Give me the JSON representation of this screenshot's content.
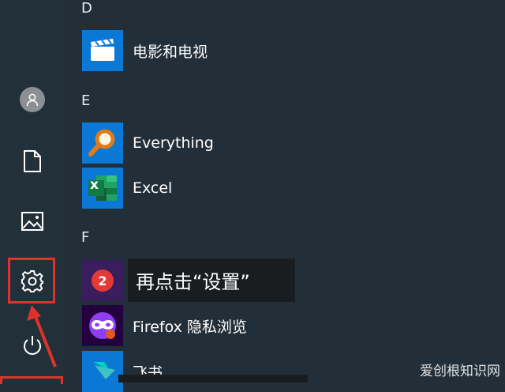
{
  "sections": {
    "d": "D",
    "e": "E",
    "f": "F"
  },
  "apps": {
    "movies": "电影和电视",
    "everything": "Everything",
    "excel": "Excel",
    "firefox_private": "Firefox 隐私浏览",
    "feishu": "飞书"
  },
  "annotation": {
    "step_number": "2",
    "instruction": "再点击“设置”"
  },
  "excel_icon_letter": "x",
  "watermark": "爱创根知识网",
  "colors": {
    "highlight": "#e0322a",
    "tile_blue": "#0a78d4",
    "excel_green": "#1d7044"
  }
}
